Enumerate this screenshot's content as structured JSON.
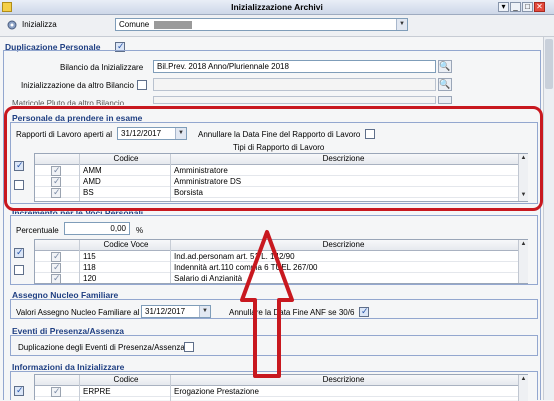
{
  "window": {
    "title": "Inizializzazione Archivi",
    "buttons": [
      "▾",
      "_",
      "□",
      "✕"
    ]
  },
  "toolbar": {
    "label": "Inizializza",
    "comune_value": "Comune"
  },
  "duplicazione": {
    "title": "Duplicazione Personale",
    "bilancio_label": "Bilancio da Inizializzare",
    "bilancio_value": "Bil.Prev. 2018 Anno/Pluriennale 2018",
    "altro_bilancio_label": "Inizializzazione da altro Bilancio",
    "mattricole_label": "Matricole Pluto da altro Bilancio"
  },
  "personale": {
    "title": "Personale da prendere in esame",
    "rapporti_label": "Rapporti di Lavoro aperti al",
    "rapporti_date": "31/12/2017",
    "annullare_label": "Annullare la Data Fine del Rapporto di Lavoro",
    "tipi_label": "Tipi di Rapporto di Lavoro",
    "columns": [
      "Codice",
      "Descrizione"
    ],
    "rows": [
      {
        "codice": "AMM",
        "descrizione": "Amministratore"
      },
      {
        "codice": "AMD",
        "descrizione": "Amministratore DS"
      },
      {
        "codice": "BS",
        "descrizione": "Borsista"
      }
    ]
  },
  "incremento": {
    "title": "Incremento per le Voci Personali",
    "percentuale_label": "Percentuale",
    "percentuale_value": "0,00",
    "percent_sign": "%",
    "columns": [
      "Codice Voce",
      "Descrizione"
    ],
    "rows": [
      {
        "codice": "115",
        "descrizione": "Ind.ad.personam art. 51 L. 142/90"
      },
      {
        "codice": "118",
        "descrizione": "Indennità art.110 comma 6 TUEL 267/00"
      },
      {
        "codice": "120",
        "descrizione": "Salario di Anzianità"
      }
    ]
  },
  "anf": {
    "title": "Assegno Nucleo Familiare",
    "valori_label": "Valori Assegno Nucleo Familiare al",
    "valori_date": "31/12/2017",
    "annullare_label": "Annullare la Data Fine ANF se 30/6"
  },
  "eventi": {
    "title": "Eventi di Presenza/Assenza",
    "duplicazione_label": "Duplicazione degli Eventi di Presenza/Assenza"
  },
  "informazioni": {
    "title": "Informazioni da Inizializzare",
    "columns": [
      "Codice",
      "Descrizione"
    ],
    "rows": [
      {
        "codice": "ERPRE",
        "descrizione": "Erogazione Prestazione"
      }
    ]
  },
  "colors": {
    "annotation": "#c8181f",
    "section_title": "#1f3f82"
  }
}
